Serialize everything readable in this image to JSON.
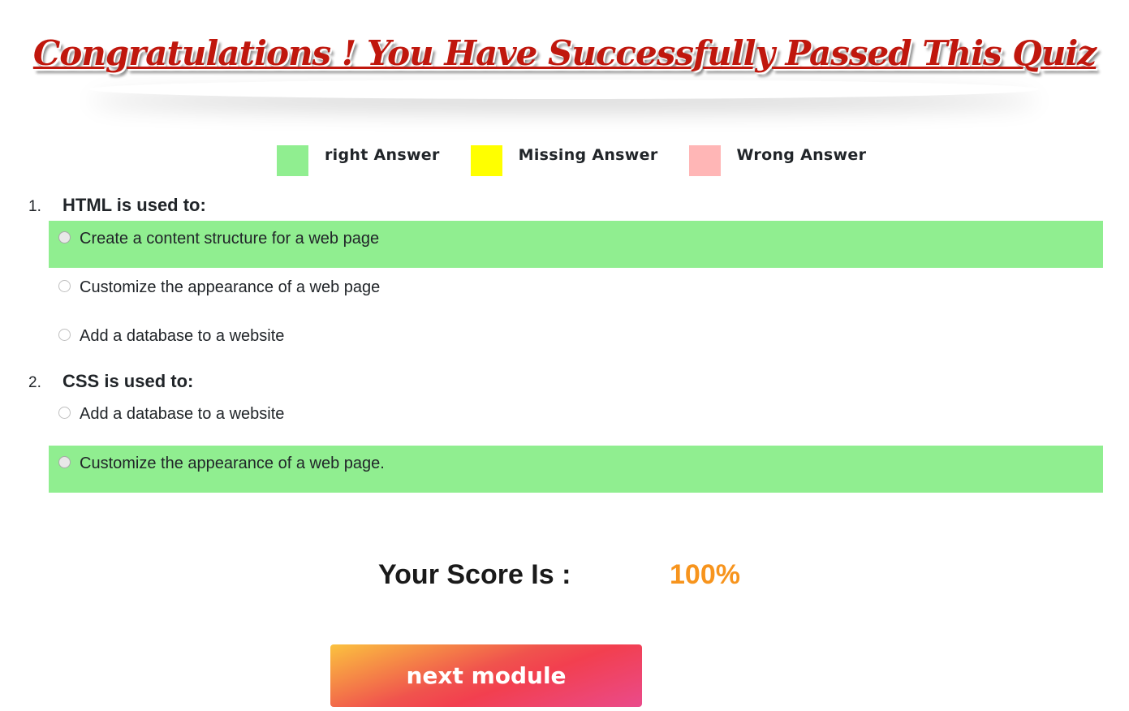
{
  "header": {
    "title": "Congratulations ! You Have Successfully Passed This Quiz"
  },
  "legend": {
    "items": [
      {
        "label": "right Answer",
        "color": "#90ee90"
      },
      {
        "label": "Missing Answer",
        "color": "#ffff00"
      },
      {
        "label": "Wrong Answer",
        "color": "#ffb6b6"
      }
    ]
  },
  "questions": [
    {
      "number": "1.",
      "text": "HTML is used to:",
      "options": [
        {
          "label": "Create a content structure for a web page",
          "status": "right"
        },
        {
          "label": "Customize the appearance of a web page",
          "status": "none"
        },
        {
          "label": "Add a database to a website",
          "status": "none"
        }
      ]
    },
    {
      "number": "2.",
      "text": "CSS is used to:",
      "options": [
        {
          "label": "Add a database to a website",
          "status": "none"
        },
        {
          "label": "Customize the appearance of a web page.",
          "status": "right"
        }
      ]
    }
  ],
  "score": {
    "label": "Your Score Is :",
    "value": "100%",
    "value_color": "#f7941d"
  },
  "actions": {
    "next_label": "next module"
  }
}
